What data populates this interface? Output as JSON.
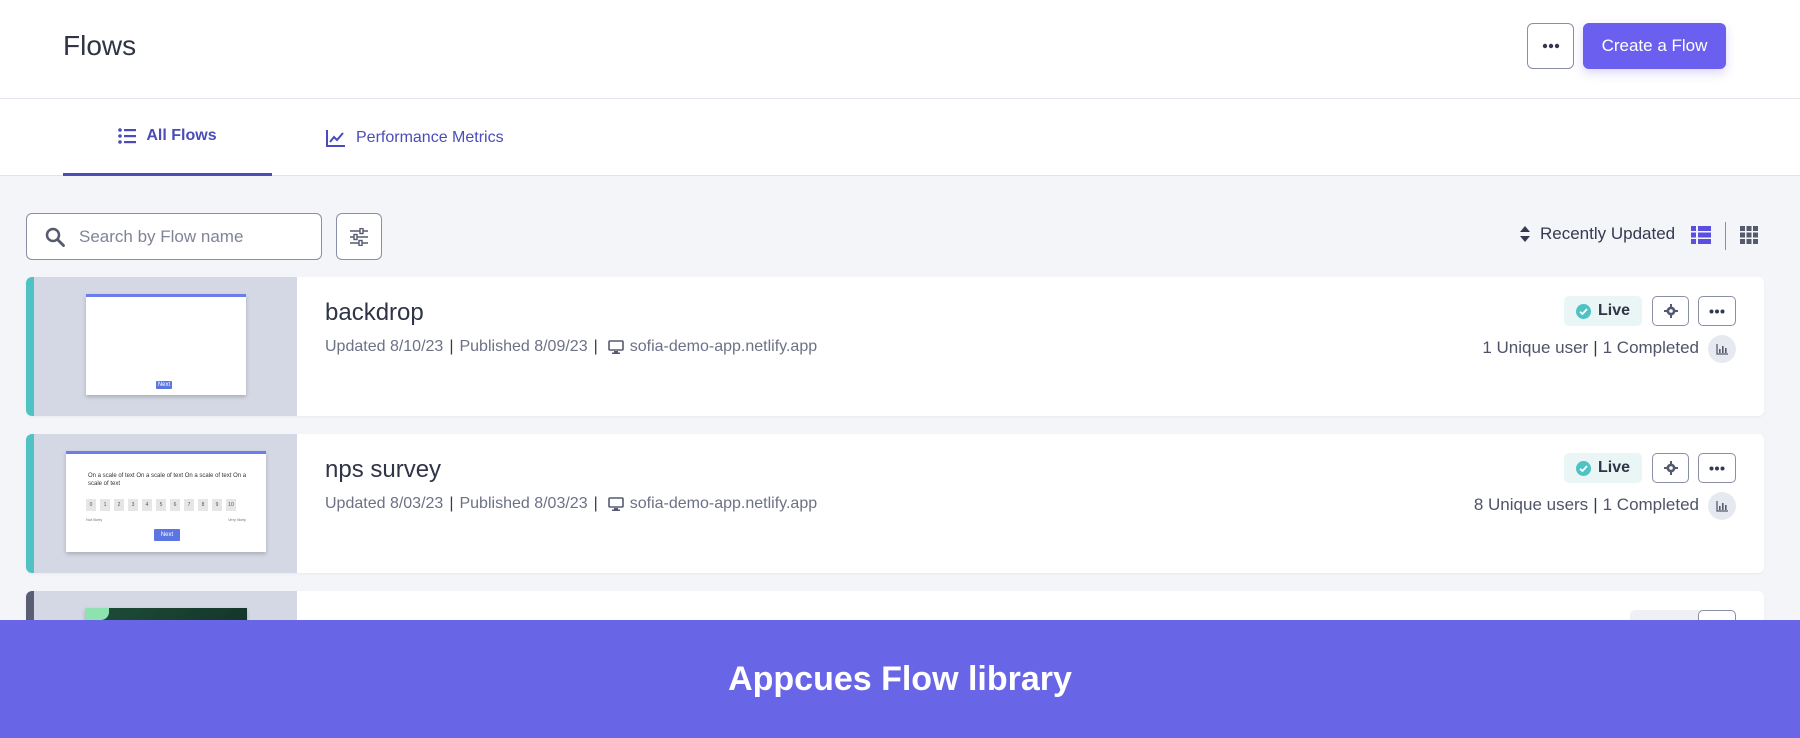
{
  "header": {
    "title": "Flows",
    "create_label": "Create a Flow"
  },
  "tabs": [
    {
      "label": "All Flows",
      "active": true
    },
    {
      "label": "Performance Metrics",
      "active": false
    }
  ],
  "search": {
    "placeholder": "Search by Flow name",
    "value": ""
  },
  "sort": {
    "label": "Recently Updated"
  },
  "flows": [
    {
      "name": "backdrop",
      "updated": "Updated 8/10/23",
      "published": "Published 8/09/23",
      "domain": "sofia-demo-app.netlify.app",
      "status": "Live",
      "users": "1 Unique user",
      "completed": "1 Completed",
      "thumb_button": "Next"
    },
    {
      "name": "nps survey",
      "updated": "Updated 8/03/23",
      "published": "Published 8/03/23",
      "domain": "sofia-demo-app.netlify.app",
      "status": "Live",
      "users": "8 Unique users",
      "completed": "1 Completed",
      "thumb_text": "On a scale of text On a scale of text On a scale of text On a scale of text",
      "thumb_scale": [
        "0",
        "1",
        "2",
        "3",
        "4",
        "5",
        "6",
        "7",
        "8",
        "9",
        "10"
      ],
      "thumb_low": "Not likely",
      "thumb_high": "Very likely",
      "thumb_button": "Next"
    }
  ],
  "banner": {
    "text": "Appcues Flow library"
  },
  "colors": {
    "accent": "#6b5ff0",
    "live_accent": "#4fc2c3",
    "banner": "#6866e7",
    "tab_active": "#4a4db8"
  }
}
